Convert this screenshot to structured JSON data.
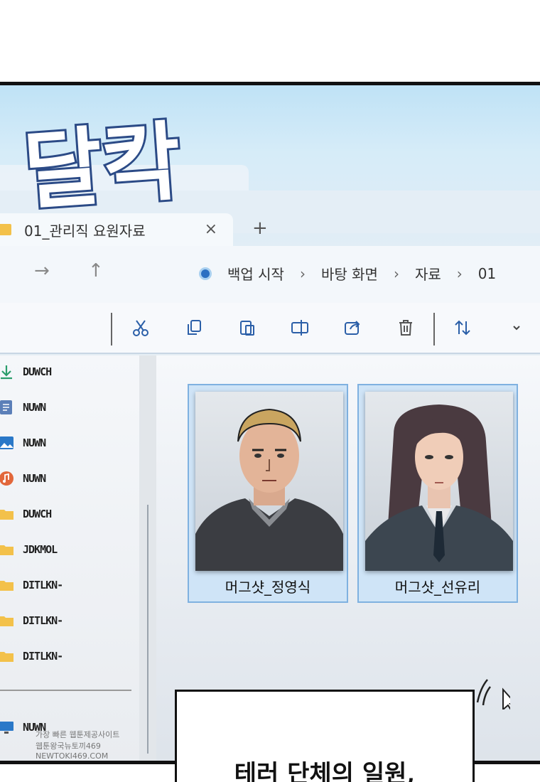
{
  "sfx": {
    "text": "달칵"
  },
  "window": {
    "tab": {
      "title": "01_관리직 요원자료"
    },
    "breadcrumbs": [
      "백업 시작",
      "바탕 화면",
      "자료",
      "01"
    ]
  },
  "sidebar": {
    "items": [
      {
        "icon": "download-icon",
        "label": "DUWCH"
      },
      {
        "icon": "document-icon",
        "label": "NUWN"
      },
      {
        "icon": "picture-icon",
        "label": "NUWN"
      },
      {
        "icon": "music-icon",
        "label": "NUWN"
      },
      {
        "icon": "folder-icon",
        "label": "DUWCH"
      },
      {
        "icon": "folder-icon",
        "label": "JDKMOL"
      },
      {
        "icon": "folder-icon",
        "label": "DITLKN-"
      },
      {
        "icon": "folder-icon",
        "label": "DITLKN-"
      },
      {
        "icon": "folder-icon",
        "label": "DITLKN-"
      },
      {
        "icon": "monitor-icon",
        "label": "NUWN"
      }
    ]
  },
  "files": [
    {
      "name": "머그샷_정영식"
    },
    {
      "name": "머그샷_선유리"
    }
  ],
  "caption": {
    "text": "테러 단체의 일원,"
  },
  "watermark": {
    "line1": "가장 빠른 웹툰제공사이트",
    "line2": "웹툰왕국뉴토끼469",
    "line3": "NEWTOKI469.COM"
  },
  "colors": {
    "accent": "#7fb1e0",
    "folder": "#f3c14a",
    "selected": "#cfe4f7"
  }
}
